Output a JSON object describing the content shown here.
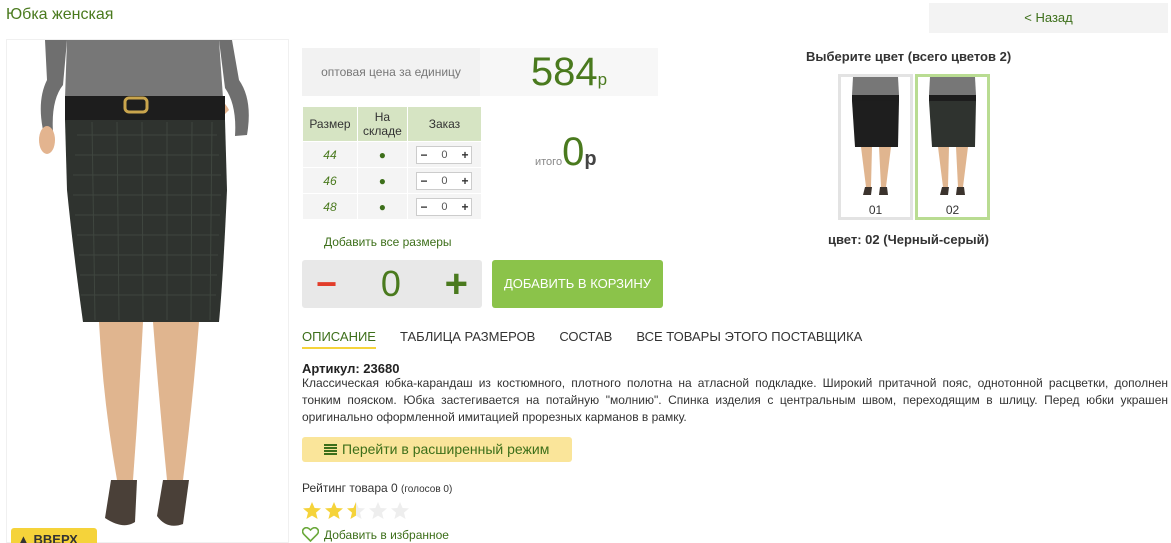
{
  "page": {
    "title": "Юбка женская",
    "back_label": "< Назад",
    "top_label": "ВВЕРХ"
  },
  "price": {
    "label": "оптовая цена за единицу",
    "value": "584",
    "currency": "р"
  },
  "sizes_table": {
    "headers": [
      "Размер",
      "На складе",
      "Заказ"
    ],
    "rows": [
      {
        "size": "44",
        "qty": "0"
      },
      {
        "size": "46",
        "qty": "0"
      },
      {
        "size": "48",
        "qty": "0"
      }
    ],
    "minus": "−",
    "plus": "+",
    "stock_mark": "●"
  },
  "total": {
    "label": "итого",
    "value": "0",
    "currency": "р"
  },
  "add_all_sizes": "Добавить все размеры",
  "stepper": {
    "minus": "−",
    "value": "0",
    "plus": "+"
  },
  "cart_button": "ДОБАВИТЬ В КОРЗИНУ",
  "colors": {
    "title": "Выберите цвет (всего цветов 2)",
    "swatches": [
      {
        "code": "01"
      },
      {
        "code": "02"
      }
    ],
    "selected_index": 1,
    "current": "цвет: 02 (Черный-серый)"
  },
  "tabs": [
    "ОПИСАНИЕ",
    "ТАБЛИЦА РАЗМЕРОВ",
    "СОСТАВ",
    "ВСЕ ТОВАРЫ ЭТОГО ПОСТАВЩИКА"
  ],
  "article": "Артикул: 23680",
  "description": "Классическая юбка-карандаш из костюмного, плотного полотна на атласной подкладке. Широкий притачной пояс, однотонной расцветки, дополнен тонким пояском. Юбка застегивается на потайную \"молнию\". Спинка изделия с центральным швом, переходящим в шлицу. Перед юбки украшен оригинально оформленной имитацией прорезных карманов в рамку.",
  "extended_mode": "Перейти в расширенный режим",
  "rating": {
    "label": "Рейтинг товара 0",
    "votes": "(голосов 0)",
    "value": 2.5,
    "max": 5
  },
  "favorites": "Добавить в избранное",
  "colors_palette": {
    "accent_green": "#4a7a1e",
    "button_green": "#8bc34a",
    "yellow": "#f5d33a",
    "minus_red": "#e23d2a"
  },
  "icons": [
    "arrow-up-icon",
    "list-icon",
    "star-icon",
    "heart-icon"
  ]
}
